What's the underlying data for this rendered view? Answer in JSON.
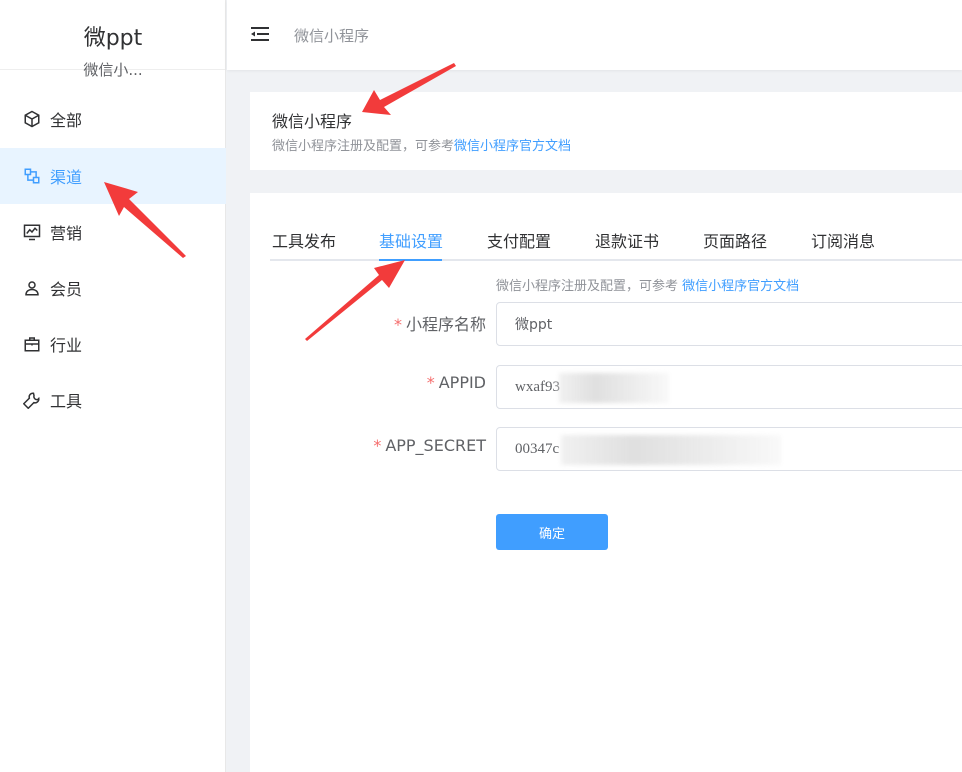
{
  "sidebar": {
    "brand_title": "微ppt",
    "brand_subtitle": "微信小...",
    "items": [
      {
        "label": "全部",
        "icon": "cube-icon",
        "active": false
      },
      {
        "label": "渠道",
        "icon": "channel-icon",
        "active": true
      },
      {
        "label": "营销",
        "icon": "monitor-chart-icon",
        "active": false
      },
      {
        "label": "会员",
        "icon": "user-icon",
        "active": false
      },
      {
        "label": "行业",
        "icon": "briefcase-icon",
        "active": false
      },
      {
        "label": "工具",
        "icon": "wrench-icon",
        "active": false
      }
    ]
  },
  "header": {
    "breadcrumb": "微信小程序"
  },
  "intro": {
    "title": "微信小程序",
    "desc_prefix": "微信小程序注册及配置，可参考",
    "desc_link": "微信小程序官方文档"
  },
  "tabs": [
    {
      "label": "工具发布"
    },
    {
      "label": "基础设置",
      "active": true
    },
    {
      "label": "支付配置"
    },
    {
      "label": "退款证书"
    },
    {
      "label": "页面路径"
    },
    {
      "label": "订阅消息"
    }
  ],
  "form": {
    "hint_prefix": "微信小程序注册及配置，可参考",
    "hint_link": "微信小程序官方文档",
    "fields": [
      {
        "label": "小程序名称",
        "required": "*",
        "value": "微ppt"
      },
      {
        "label": "APPID",
        "required": "*",
        "value": "wxaf93"
      },
      {
        "label": "APP_SECRET",
        "required": "*",
        "value": "00347c"
      }
    ],
    "confirm_label": "确定"
  },
  "colors": {
    "primary": "#409eff",
    "active_bg": "#e8f4ff",
    "required": "#f56c6c",
    "arrow": "#f23b3b"
  }
}
